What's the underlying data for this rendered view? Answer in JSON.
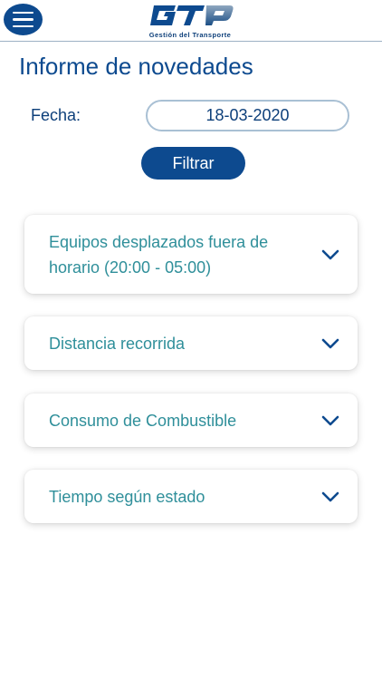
{
  "header": {
    "logo_text": "GTP",
    "logo_subtitle": "Gestión del Transporte"
  },
  "page": {
    "title": "Informe de novedades"
  },
  "filter": {
    "date_label": "Fecha:",
    "date_value": "18-03-2020",
    "button_label": "Filtrar"
  },
  "sections": [
    {
      "label": "Equipos desplazados fuera de horario (20:00 - 05:00)"
    },
    {
      "label": "Distancia recorrida"
    },
    {
      "label": "Consumo de Combustible"
    },
    {
      "label": "Tiempo según estado"
    }
  ],
  "colors": {
    "primary": "#0d4a8f",
    "accent_text": "#2f8f9a",
    "border": "#a9c0d4"
  }
}
